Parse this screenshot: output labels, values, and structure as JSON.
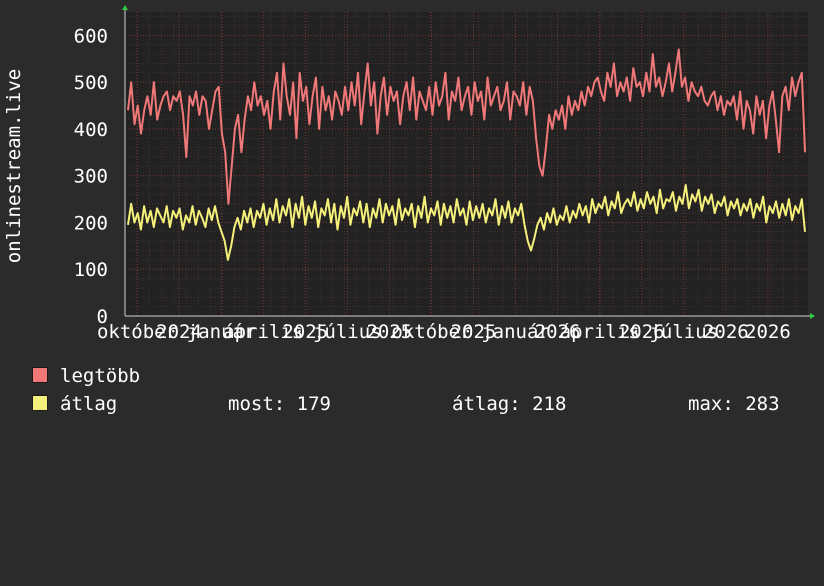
{
  "chart_data": {
    "type": "line",
    "ylabel": "onlinestream.live",
    "ylim": [
      0,
      600
    ],
    "yticks": [
      0,
      100,
      200,
      300,
      400,
      500,
      600
    ],
    "xtick_labels": [
      "október",
      "2024",
      "január",
      "április",
      "2025",
      "július",
      "2025",
      "október",
      "2025",
      "január",
      "2026",
      "április",
      "2026",
      "július",
      "2026",
      "2026"
    ],
    "grid": true,
    "legend_placement": "bottom-left",
    "series": [
      {
        "name": "legtöbb",
        "color": "#f07878",
        "values": [
          440,
          500,
          410,
          450,
          390,
          440,
          470,
          430,
          500,
          420,
          450,
          470,
          480,
          440,
          470,
          460,
          480,
          430,
          340,
          470,
          450,
          480,
          430,
          470,
          460,
          400,
          440,
          480,
          490,
          390,
          350,
          240,
          320,
          400,
          430,
          350,
          420,
          470,
          440,
          500,
          450,
          470,
          430,
          460,
          400,
          480,
          520,
          420,
          540,
          470,
          430,
          500,
          380,
          520,
          460,
          490,
          410,
          470,
          510,
          400,
          490,
          440,
          470,
          420,
          480,
          460,
          430,
          490,
          440,
          500,
          450,
          520,
          410,
          480,
          540,
          450,
          500,
          390,
          470,
          510,
          430,
          490,
          460,
          480,
          410,
          470,
          500,
          440,
          510,
          420,
          480,
          460,
          440,
          490,
          430,
          500,
          450,
          470,
          520,
          420,
          480,
          460,
          510,
          440,
          470,
          490,
          430,
          500,
          460,
          480,
          420,
          510,
          450,
          470,
          490,
          440,
          460,
          500,
          420,
          480,
          470,
          450,
          500,
          430,
          490,
          460,
          380,
          320,
          300,
          360,
          430,
          400,
          440,
          420,
          450,
          400,
          470,
          430,
          460,
          440,
          480,
          450,
          490,
          470,
          500,
          510,
          480,
          460,
          520,
          490,
          540,
          470,
          500,
          480,
          510,
          460,
          530,
          490,
          500,
          470,
          520,
          480,
          560,
          490,
          510,
          470,
          500,
          540,
          480,
          520,
          570,
          490,
          510,
          460,
          500,
          480,
          470,
          490,
          460,
          450,
          470,
          480,
          440,
          470,
          430,
          460,
          450,
          470,
          420,
          480,
          400,
          460,
          440,
          390,
          470,
          430,
          460,
          380,
          450,
          480,
          420,
          350,
          470,
          490,
          440,
          510,
          470,
          500,
          520,
          350
        ]
      },
      {
        "name": "átlag",
        "color": "#f5f07a",
        "values": [
          195,
          240,
          200,
          220,
          185,
          235,
          200,
          225,
          190,
          230,
          215,
          200,
          235,
          190,
          225,
          210,
          230,
          185,
          215,
          200,
          235,
          195,
          225,
          210,
          190,
          230,
          205,
          235,
          200,
          180,
          160,
          120,
          150,
          190,
          210,
          185,
          225,
          200,
          230,
          190,
          225,
          210,
          240,
          195,
          230,
          205,
          250,
          200,
          235,
          215,
          250,
          190,
          240,
          210,
          255,
          195,
          235,
          210,
          245,
          190,
          230,
          215,
          250,
          200,
          240,
          185,
          235,
          210,
          255,
          195,
          230,
          215,
          245,
          200,
          240,
          190,
          230,
          210,
          250,
          200,
          240,
          215,
          235,
          195,
          250,
          205,
          230,
          215,
          240,
          190,
          235,
          210,
          255,
          200,
          230,
          215,
          245,
          195,
          240,
          210,
          235,
          200,
          250,
          215,
          230,
          195,
          245,
          205,
          235,
          210,
          240,
          200,
          230,
          215,
          250,
          195,
          235,
          210,
          245,
          200,
          230,
          215,
          240,
          195,
          160,
          140,
          165,
          195,
          210,
          185,
          220,
          200,
          230,
          195,
          215,
          205,
          235,
          200,
          225,
          210,
          240,
          215,
          235,
          200,
          250,
          220,
          240,
          230,
          255,
          215,
          245,
          230,
          265,
          220,
          240,
          250,
          235,
          265,
          225,
          250,
          230,
          265,
          240,
          255,
          220,
          270,
          230,
          250,
          245,
          265,
          225,
          255,
          240,
          280,
          230,
          260,
          245,
          270,
          225,
          255,
          240,
          260,
          220,
          245,
          235,
          255,
          215,
          245,
          230,
          250,
          215,
          240,
          225,
          250,
          210,
          240,
          225,
          255,
          200,
          235,
          220,
          245,
          210,
          240,
          215,
          250,
          205,
          235,
          220,
          250,
          180
        ]
      }
    ]
  },
  "legend": {
    "max_label": "legtöbb",
    "avg_label": "átlag",
    "now_text": "most: 179",
    "avg_text": "átlag: 218",
    "max_text": "max: 283"
  }
}
